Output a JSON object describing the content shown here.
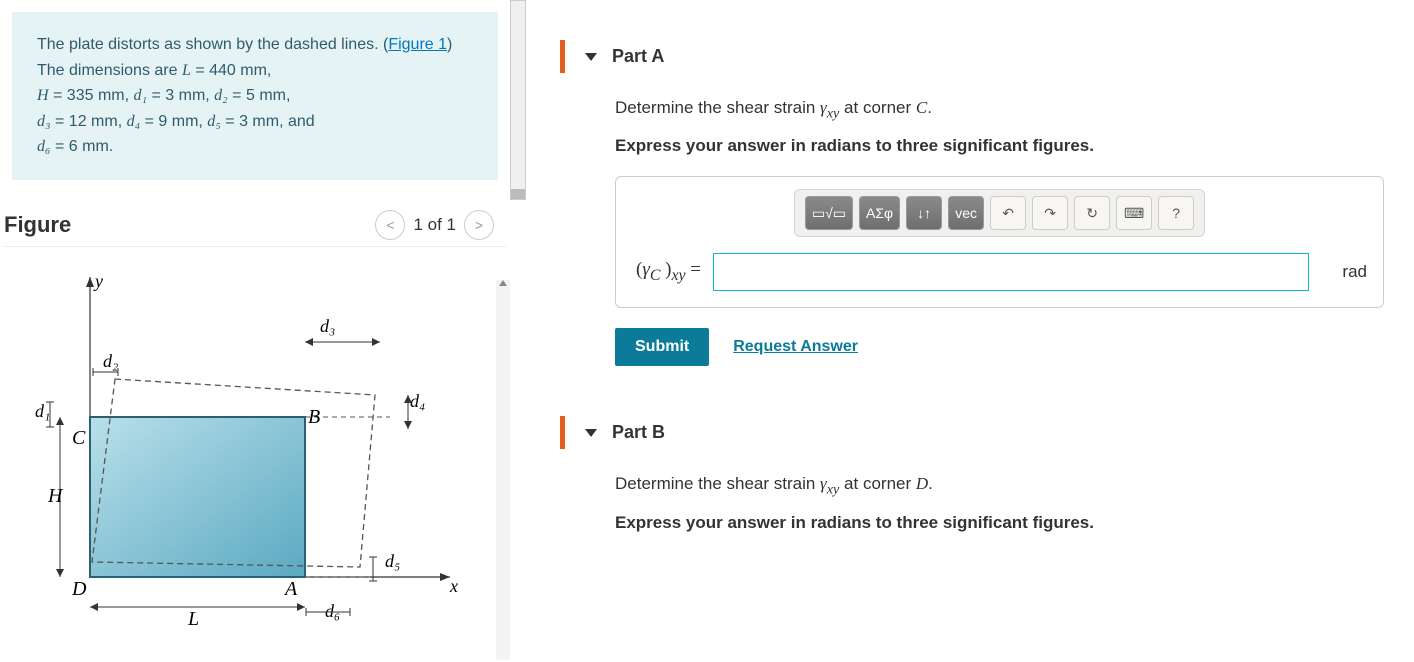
{
  "problem": {
    "intro_a": "The plate distorts as shown by the dashed lines. (",
    "link": "Figure 1",
    "intro_b": ") The dimensions are ",
    "L_var": "L",
    "L_val": " = 440 mm",
    "H_var": "H",
    "H_val": " = 335 mm",
    "d1_var": "d₁",
    "d1_val": " = 3 mm",
    "d2_var": "d₂",
    "d2_val": " = 5 mm",
    "d3_var": "d₃",
    "d3_val": " = 12 mm",
    "d4_var": "d₄",
    "d4_val": " = 9 mm",
    "d5_var": "d₅",
    "d5_val": " = 3 mm",
    "and": ", and",
    "d6_var": "d₆",
    "d6_val": " = 6 mm",
    "period": "."
  },
  "figure": {
    "title": "Figure",
    "nav_label": "1 of 1",
    "labels": {
      "y": "y",
      "x": "x",
      "d1": "d₁",
      "d2": "d₂",
      "d3": "d₃",
      "d4": "d₄",
      "d5": "d₅",
      "d6": "d₆",
      "L": "L",
      "H": "H",
      "A": "A",
      "B": "B",
      "C": "C",
      "D": "D"
    }
  },
  "toolbar": {
    "templates": "▭√▭",
    "greek": "ΑΣφ",
    "arrows": "↓↑",
    "vec": "vec",
    "undo": "↶",
    "redo": "↷",
    "reset": "↻",
    "keyboard": "⌨",
    "help": "?"
  },
  "partA": {
    "title": "Part A",
    "prompt_pre": "Determine the shear strain ",
    "prompt_sym": "γ",
    "prompt_sub": "xy",
    "prompt_post": " at corner ",
    "corner": "C",
    "instruct": "Express your answer in radians to three significant figures.",
    "lhs": "(γC )xy =",
    "unit": "rad",
    "submit": "Submit",
    "request": "Request Answer"
  },
  "partB": {
    "title": "Part B",
    "prompt_pre": "Determine the shear strain ",
    "prompt_sym": "γ",
    "prompt_sub": "xy",
    "prompt_post": " at corner ",
    "corner": "D",
    "instruct": "Express your answer in radians to three significant figures."
  }
}
